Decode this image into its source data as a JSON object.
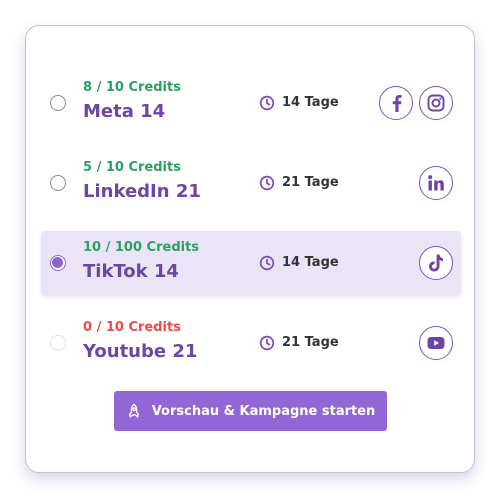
{
  "campaigns": [
    {
      "credits": "8 / 10 Credits",
      "name": "Meta 14",
      "duration": "14 Tage",
      "selected": false,
      "platforms": [
        "facebook-icon",
        "instagram-icon"
      ]
    },
    {
      "credits": "5 / 10 Credits",
      "name": "LinkedIn 21",
      "duration": "21 Tage",
      "selected": false,
      "platforms": [
        "linkedin-icon"
      ]
    },
    {
      "credits": "10 / 100 Credits",
      "name": "TikTok 14",
      "duration": "14 Tage",
      "selected": true,
      "platforms": [
        "tiktok-icon"
      ]
    },
    {
      "credits": "0 / 10 Credits",
      "name": "Youtube 21",
      "duration": "21 Tage",
      "selected": false,
      "disabled": true,
      "platforms": [
        "youtube-icon"
      ]
    }
  ],
  "start_button": {
    "label": "Vorschau & Kampagne starten",
    "icon": "rocket-icon"
  },
  "colors": {
    "accent": "#9266d4",
    "name_text": "#6b46a6",
    "credits_ok": "#2aa163",
    "credits_empty": "#ef4a4a",
    "selected_row_bg": "#ebe4f7"
  }
}
